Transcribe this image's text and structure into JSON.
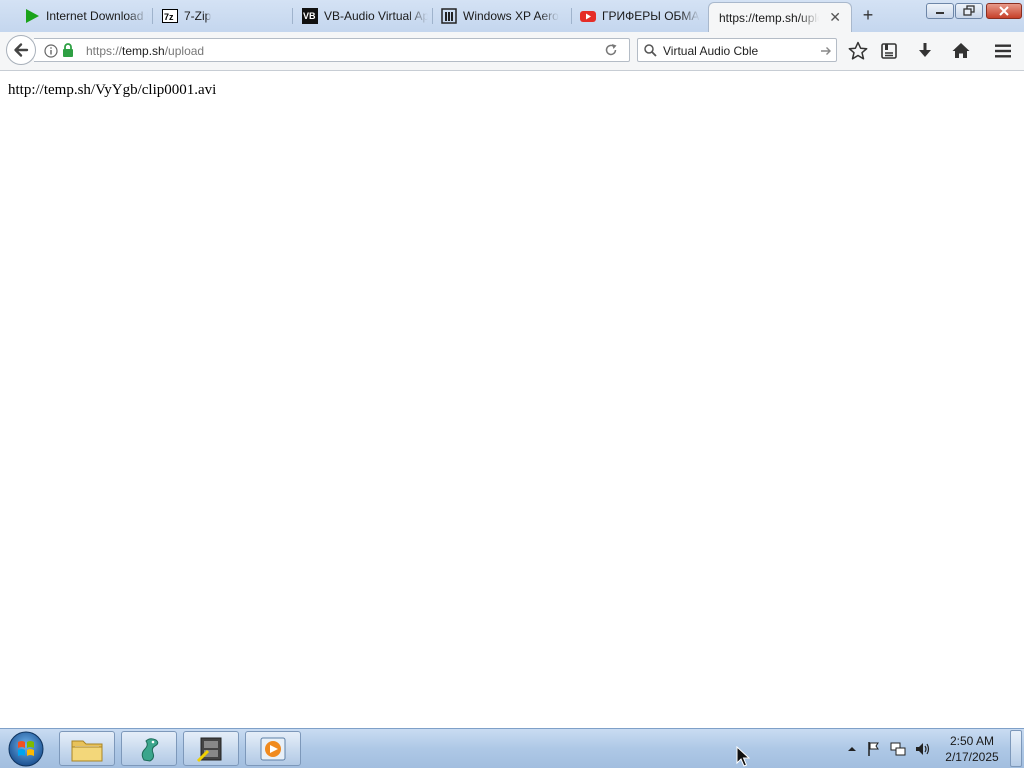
{
  "browser": {
    "tabs": [
      {
        "title": "Internet Download Manager",
        "icon": "idm-play-icon",
        "selected": false
      },
      {
        "title": "7-Zip",
        "icon": "7zip-icon",
        "selected": false
      },
      {
        "title": "VB-Audio Virtual Apps",
        "icon": "vb-audio-icon",
        "selected": false
      },
      {
        "title": "Windows XP Aero",
        "icon": "archive-icon",
        "selected": false
      },
      {
        "title": "ГРИФЕРЫ ОБМАНУЛИ",
        "icon": "youtube-icon",
        "selected": false
      },
      {
        "title": "https://temp.sh/upload",
        "icon": "",
        "selected": true
      }
    ],
    "new_tab_label": "+",
    "url": {
      "scheme": "https://",
      "host": "temp.sh",
      "path": "/upload"
    },
    "search_value": "Virtual Audio Cble"
  },
  "page": {
    "text": "http://temp.sh/VyYgb/clip0001.avi"
  },
  "taskbar": {
    "apps": [
      "file-explorer",
      "seahorse-app",
      "media-tool-app",
      "media-player-app"
    ],
    "clock_time": "2:50 AM",
    "clock_date": "2/17/2025"
  }
}
